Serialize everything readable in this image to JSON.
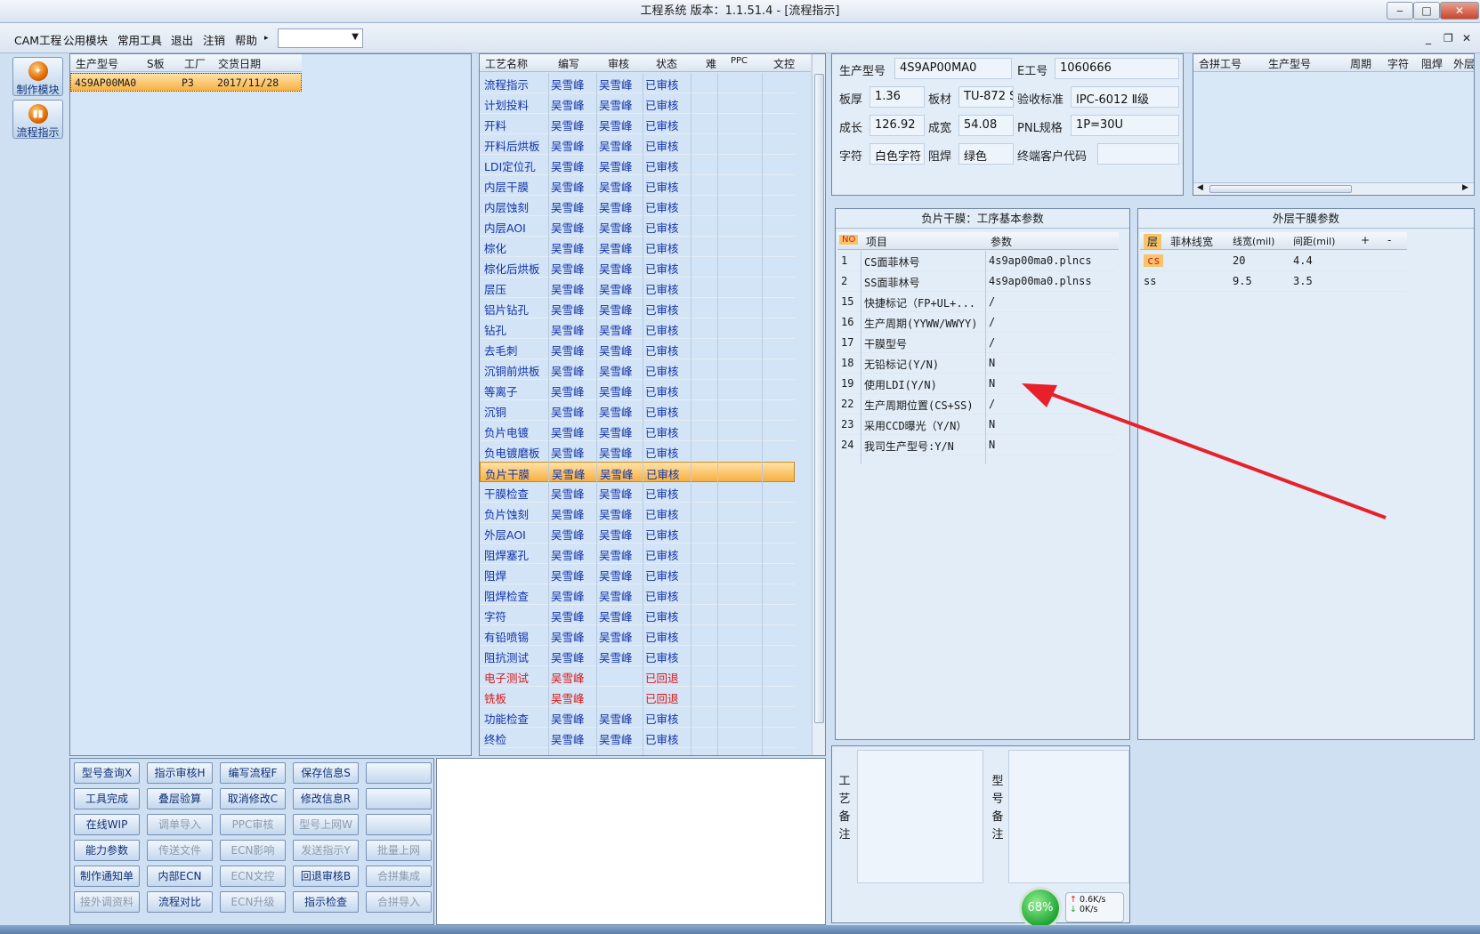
{
  "window": {
    "title": "工程系统    版本：1.1.51.4 - [流程指示]"
  },
  "menu": {
    "items": [
      "CAM工程",
      "公用模块",
      "常用工具",
      "退出",
      "注销",
      "帮助"
    ],
    "help_arrow": "▸",
    "dropdown_value": ""
  },
  "sidebar": {
    "items": [
      {
        "label": "制作模块",
        "icon": "make-module-icon"
      },
      {
        "label": "流程指示",
        "icon": "flow-instruction-icon"
      }
    ]
  },
  "orders": {
    "headers": [
      "生产型号",
      "S板",
      "工厂",
      "交货日期"
    ],
    "rows": [
      {
        "model": "4S9AP00MA0",
        "sboard": "",
        "factory": "P3",
        "date": "2017/11/28"
      }
    ]
  },
  "process": {
    "headers": [
      "工艺名称",
      "编写",
      "审核",
      "状态",
      "难",
      "PPC",
      "文控"
    ],
    "rows": [
      {
        "name": "流程指示",
        "writer": "吴雪峰",
        "reviewer": "吴雪峰",
        "status": "已审核"
      },
      {
        "name": "计划投料",
        "writer": "吴雪峰",
        "reviewer": "吴雪峰",
        "status": "已审核"
      },
      {
        "name": "开料",
        "writer": "吴雪峰",
        "reviewer": "吴雪峰",
        "status": "已审核"
      },
      {
        "name": "开料后烘板",
        "writer": "吴雪峰",
        "reviewer": "吴雪峰",
        "status": "已审核"
      },
      {
        "name": "LDI定位孔",
        "writer": "吴雪峰",
        "reviewer": "吴雪峰",
        "status": "已审核"
      },
      {
        "name": "内层干膜",
        "writer": "吴雪峰",
        "reviewer": "吴雪峰",
        "status": "已审核"
      },
      {
        "name": "内层蚀刻",
        "writer": "吴雪峰",
        "reviewer": "吴雪峰",
        "status": "已审核"
      },
      {
        "name": "内层AOI",
        "writer": "吴雪峰",
        "reviewer": "吴雪峰",
        "status": "已审核"
      },
      {
        "name": "棕化",
        "writer": "吴雪峰",
        "reviewer": "吴雪峰",
        "status": "已审核"
      },
      {
        "name": "棕化后烘板",
        "writer": "吴雪峰",
        "reviewer": "吴雪峰",
        "status": "已审核"
      },
      {
        "name": "层压",
        "writer": "吴雪峰",
        "reviewer": "吴雪峰",
        "status": "已审核"
      },
      {
        "name": "铝片钻孔",
        "writer": "吴雪峰",
        "reviewer": "吴雪峰",
        "status": "已审核"
      },
      {
        "name": "钻孔",
        "writer": "吴雪峰",
        "reviewer": "吴雪峰",
        "status": "已审核"
      },
      {
        "name": "去毛刺",
        "writer": "吴雪峰",
        "reviewer": "吴雪峰",
        "status": "已审核"
      },
      {
        "name": "沉铜前烘板",
        "writer": "吴雪峰",
        "reviewer": "吴雪峰",
        "status": "已审核"
      },
      {
        "name": "等离子",
        "writer": "吴雪峰",
        "reviewer": "吴雪峰",
        "status": "已审核"
      },
      {
        "name": "沉铜",
        "writer": "吴雪峰",
        "reviewer": "吴雪峰",
        "status": "已审核"
      },
      {
        "name": "负片电镀",
        "writer": "吴雪峰",
        "reviewer": "吴雪峰",
        "status": "已审核"
      },
      {
        "name": "负电镀磨板",
        "writer": "吴雪峰",
        "reviewer": "吴雪峰",
        "status": "已审核"
      },
      {
        "name": "负片干膜",
        "writer": "吴雪峰",
        "reviewer": "吴雪峰",
        "status": "已审核"
      },
      {
        "name": "干膜检查",
        "writer": "吴雪峰",
        "reviewer": "吴雪峰",
        "status": "已审核"
      },
      {
        "name": "负片蚀刻",
        "writer": "吴雪峰",
        "reviewer": "吴雪峰",
        "status": "已审核"
      },
      {
        "name": "外层AOI",
        "writer": "吴雪峰",
        "reviewer": "吴雪峰",
        "status": "已审核"
      },
      {
        "name": "阻焊塞孔",
        "writer": "吴雪峰",
        "reviewer": "吴雪峰",
        "status": "已审核"
      },
      {
        "name": "阻焊",
        "writer": "吴雪峰",
        "reviewer": "吴雪峰",
        "status": "已审核"
      },
      {
        "name": "阻焊检查",
        "writer": "吴雪峰",
        "reviewer": "吴雪峰",
        "status": "已审核"
      },
      {
        "name": "字符",
        "writer": "吴雪峰",
        "reviewer": "吴雪峰",
        "status": "已审核"
      },
      {
        "name": "有铅喷锡",
        "writer": "吴雪峰",
        "reviewer": "吴雪峰",
        "status": "已审核"
      },
      {
        "name": "阻抗测试",
        "writer": "吴雪峰",
        "reviewer": "吴雪峰",
        "status": "已审核"
      },
      {
        "name": "电子测试",
        "writer": "吴雪峰",
        "reviewer": "",
        "status": "已回退",
        "returned": true
      },
      {
        "name": "铣板",
        "writer": "吴雪峰",
        "reviewer": "",
        "status": "已回退",
        "returned": true
      },
      {
        "name": "功能检查",
        "writer": "吴雪峰",
        "reviewer": "吴雪峰",
        "status": "已审核"
      },
      {
        "name": "终检",
        "writer": "吴雪峰",
        "reviewer": "吴雪峰",
        "status": "已审核"
      }
    ],
    "selected_index": 19
  },
  "info": {
    "model_label": "生产型号",
    "model": "4S9AP00MA0",
    "eno_label": "E工号",
    "eno": "1060666",
    "thickness_label": "板厚",
    "thickness": "1.36",
    "material_label": "板材",
    "material": "TU-872 S",
    "standard_label": "验收标准",
    "standard": "IPC-6012 Ⅱ级",
    "length_label": "成长",
    "length": "126.92",
    "width_label": "成宽",
    "width": "54.08",
    "pnl_label": "PNL规格",
    "pnl": "1P=30U",
    "char_label": "字符",
    "char": "白色字符",
    "mask_label": "阻焊",
    "mask": "绿色",
    "cust_label": "终端客户代码",
    "cust": ""
  },
  "combo": {
    "headers": [
      "合拼工号",
      "生产型号",
      "周期",
      "字符",
      "阻焊",
      "外层"
    ]
  },
  "params": {
    "title": "负片干膜：工序基本参数",
    "headers": [
      "NO",
      "项目",
      "参数"
    ],
    "rows": [
      {
        "no": "1",
        "item": "CS面菲林号",
        "value": "4s9ap00ma0.plncs"
      },
      {
        "no": "2",
        "item": "SS面菲林号",
        "value": "4s9ap00ma0.plnss"
      },
      {
        "no": "15",
        "item": "快捷标记（FP+UL+...",
        "value": "/"
      },
      {
        "no": "16",
        "item": "生产周期(YYWW/WWYY)",
        "value": "/"
      },
      {
        "no": "17",
        "item": "干膜型号",
        "value": "/"
      },
      {
        "no": "18",
        "item": "无铅标记(Y/N)",
        "value": "N"
      },
      {
        "no": "19",
        "item": "使用LDI(Y/N)",
        "value": "N"
      },
      {
        "no": "22",
        "item": "生产周期位置(CS+SS)",
        "value": "/"
      },
      {
        "no": "23",
        "item": "采用CCD曝光（Y/N）",
        "value": "N"
      },
      {
        "no": "24",
        "item": "我司生产型号:Y/N",
        "value": "N"
      }
    ]
  },
  "outer": {
    "title": "外层干膜参数",
    "headers": [
      "层",
      "菲林线宽",
      "线宽(mil)",
      "间距(mil)",
      "+",
      "-"
    ],
    "rows": [
      {
        "layer": "cs",
        "film": "",
        "line": "20",
        "space": "4.4"
      },
      {
        "layer": "ss",
        "film": "",
        "line": "9.5",
        "space": "3.5"
      }
    ]
  },
  "notes": {
    "process_label": "工艺备注",
    "model_label": "型号备注"
  },
  "net": {
    "percent": "68%",
    "up": "0.6K/s",
    "down": "0K/s"
  },
  "buttons": [
    [
      {
        "label": "型号查询X",
        "enabled": true
      },
      {
        "label": "指示审核H",
        "enabled": true
      },
      {
        "label": "编写流程F",
        "enabled": true
      },
      {
        "label": "保存信息S",
        "enabled": true
      },
      {
        "label": "",
        "enabled": true
      }
    ],
    [
      {
        "label": "工具完成",
        "enabled": true
      },
      {
        "label": "叠层验算",
        "enabled": true
      },
      {
        "label": "取消修改C",
        "enabled": true
      },
      {
        "label": "修改信息R",
        "enabled": true
      },
      {
        "label": "",
        "enabled": true
      }
    ],
    [
      {
        "label": "在线WIP",
        "enabled": true
      },
      {
        "label": "调单导入",
        "enabled": false
      },
      {
        "label": "PPC审核",
        "enabled": false
      },
      {
        "label": "型号上网W",
        "enabled": false
      },
      {
        "label": "",
        "enabled": true
      }
    ],
    [
      {
        "label": "能力参数",
        "enabled": true
      },
      {
        "label": "传送文件",
        "enabled": false
      },
      {
        "label": "ECN影响",
        "enabled": false
      },
      {
        "label": "发送指示Y",
        "enabled": false
      },
      {
        "label": "批量上网",
        "enabled": false
      }
    ],
    [
      {
        "label": "制作通知单",
        "enabled": true
      },
      {
        "label": "内部ECN",
        "enabled": true
      },
      {
        "label": "ECN文控",
        "enabled": false
      },
      {
        "label": "回退审核B",
        "enabled": true
      },
      {
        "label": "合拼集成",
        "enabled": false
      }
    ],
    [
      {
        "label": "接外调资料",
        "enabled": false
      },
      {
        "label": "流程对比",
        "enabled": true
      },
      {
        "label": "ECN升级",
        "enabled": false
      },
      {
        "label": "指示检查",
        "enabled": true
      },
      {
        "label": "合拼导入",
        "enabled": false
      }
    ]
  ],
  "colors": {
    "accent": "#1233a8",
    "returned": "#d81a1a",
    "selected": "#f7b042",
    "arrow": "#e8202a"
  }
}
